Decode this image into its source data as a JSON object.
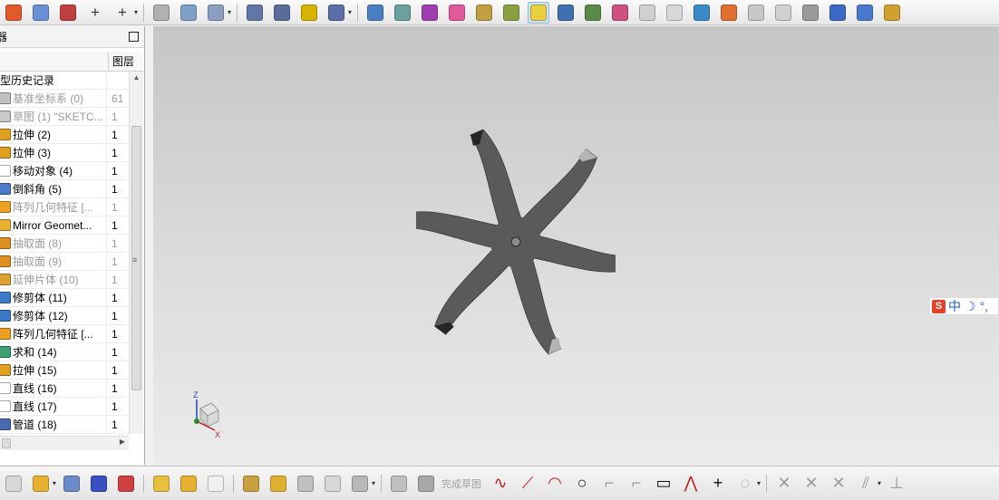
{
  "top_toolbar": {
    "icons": [
      {
        "name": "sketch-icon",
        "color": "#e25a2a"
      },
      {
        "name": "extrude-section-icon",
        "color": "#6b8fd6"
      },
      {
        "name": "curve-icon",
        "color": "#c04040"
      },
      {
        "name": "point-icon",
        "glyph": "+"
      },
      {
        "name": "point-set-icon",
        "glyph": "+"
      },
      {
        "name": "offset-curve-icon",
        "color": "#b0b0b0"
      },
      {
        "name": "surface-icon",
        "color": "#7fa0c8"
      },
      {
        "name": "trim-sheet-icon",
        "color": "#8a9ec2"
      },
      {
        "name": "cylinder-icon",
        "color": "#6077a8"
      },
      {
        "name": "spring-icon",
        "color": "#5a6c9a"
      },
      {
        "name": "thread-icon",
        "color": "#d8b400"
      },
      {
        "name": "edge-blend-icon",
        "color": "#5a6fa8"
      },
      {
        "name": "render-icon",
        "color": "#4a7fc4"
      },
      {
        "name": "camera-icon",
        "color": "#6aa0a0"
      },
      {
        "name": "paint-icon",
        "color": "#a040b0"
      },
      {
        "name": "spheres-icon",
        "color": "#e05a9a"
      },
      {
        "name": "material-icon",
        "color": "#c0a040"
      },
      {
        "name": "spotlight-icon",
        "color": "#8aa040"
      },
      {
        "name": "highlight-icon",
        "color": "#e8d040"
      },
      {
        "name": "user-icon",
        "color": "#4070b0"
      },
      {
        "name": "scene-icon",
        "color": "#5a8a4a"
      },
      {
        "name": "palette-icon",
        "color": "#d05080"
      },
      {
        "name": "display-icon",
        "color": "#d0d0d0"
      },
      {
        "name": "bodies-icon",
        "color": "#d8d8d8"
      },
      {
        "name": "shaded-cube-icon",
        "color": "#3a8ac8"
      },
      {
        "name": "image-icon",
        "color": "#e07030"
      },
      {
        "name": "wireframe-icon",
        "color": "#c8c8c8"
      },
      {
        "name": "hidden-edges-icon",
        "color": "#d0d0d0"
      },
      {
        "name": "box-select-icon",
        "color": "#9a9a9a"
      },
      {
        "name": "view-icon",
        "color": "#3a6ac8"
      },
      {
        "name": "snap-view-icon",
        "color": "#4a7ad0"
      },
      {
        "name": "view-settings-icon",
        "color": "#d0a030"
      }
    ],
    "active_index": 18
  },
  "navigator": {
    "title": "器",
    "column_name": "",
    "column_layer": "图层",
    "rows": [
      {
        "label": "型历史记录",
        "layer": "",
        "icon": "history-folder-icon",
        "color": "#ffffff",
        "disabled": false,
        "indent": -1
      },
      {
        "label": "基准坐标系 (0)",
        "layer": "61",
        "icon": "datum-csys-icon",
        "color": "#c0c0c0",
        "disabled": true
      },
      {
        "label": "草图 (1) \"SKETC...",
        "layer": "1",
        "icon": "sketch-feature-icon",
        "color": "#c8c8c8",
        "disabled": true
      },
      {
        "label": "拉伸 (2)",
        "layer": "1",
        "icon": "extrude-icon",
        "color": "#e0a020",
        "disabled": false
      },
      {
        "label": "拉伸 (3)",
        "layer": "1",
        "icon": "extrude-icon",
        "color": "#e0a020",
        "disabled": false
      },
      {
        "label": "移动对象 (4)",
        "layer": "1",
        "icon": "move-object-icon",
        "color": "#ffffff",
        "disabled": false
      },
      {
        "label": "倒斜角 (5)",
        "layer": "1",
        "icon": "chamfer-icon",
        "color": "#4a7ac8",
        "disabled": false
      },
      {
        "label": "阵列几何特征 [...",
        "layer": "1",
        "icon": "pattern-geometry-icon",
        "color": "#f0a020",
        "disabled": true
      },
      {
        "label": "Mirror Geomet...",
        "layer": "1",
        "icon": "mirror-geometry-icon",
        "color": "#e8b030",
        "disabled": false
      },
      {
        "label": "抽取面 (8)",
        "layer": "1",
        "icon": "extract-face-icon",
        "color": "#e09020",
        "disabled": true
      },
      {
        "label": "抽取面 (9)",
        "layer": "1",
        "icon": "extract-face-icon",
        "color": "#e09020",
        "disabled": true
      },
      {
        "label": "延伸片体 (10)",
        "layer": "1",
        "icon": "extend-sheet-icon",
        "color": "#e0a030",
        "disabled": true
      },
      {
        "label": "修剪体 (11)",
        "layer": "1",
        "icon": "trim-body-icon",
        "color": "#3a7ac8",
        "disabled": false
      },
      {
        "label": "修剪体 (12)",
        "layer": "1",
        "icon": "trim-body-icon",
        "color": "#3a7ac8",
        "disabled": false
      },
      {
        "label": "阵列几何特征 [...",
        "layer": "1",
        "icon": "pattern-geometry-icon",
        "color": "#f0a020",
        "disabled": false
      },
      {
        "label": "求和 (14)",
        "layer": "1",
        "icon": "unite-icon",
        "color": "#3aa070",
        "disabled": false
      },
      {
        "label": "拉伸 (15)",
        "layer": "1",
        "icon": "extrude-icon",
        "color": "#e0a020",
        "disabled": false
      },
      {
        "label": "直线 (16)",
        "layer": "1",
        "icon": "line-icon",
        "color": "#ffffff",
        "disabled": false
      },
      {
        "label": "直线 (17)",
        "layer": "1",
        "icon": "line-icon",
        "color": "#ffffff",
        "disabled": false
      },
      {
        "label": "管道 (18)",
        "layer": "1",
        "icon": "tube-icon",
        "color": "#4a6ab0",
        "disabled": false
      }
    ]
  },
  "viewport": {
    "triad": {
      "z": "Z",
      "x": "X"
    },
    "model_color": "#5a5a5a",
    "tip_color": "#b4b4b4"
  },
  "ime": {
    "s": "S",
    "mode": "中",
    "moon": "☽",
    "punc": "°,"
  },
  "bottom_toolbar": {
    "finish_sketch": "完成草图"
  }
}
